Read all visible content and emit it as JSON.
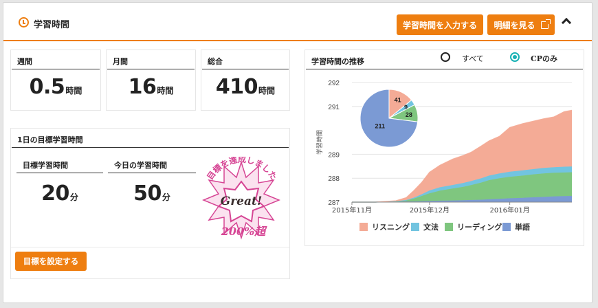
{
  "header": {
    "title": "学習時間",
    "input_button": "学習時間を入力する",
    "detail_button": "明細を見る"
  },
  "stats": {
    "weekly": {
      "label": "週間",
      "value": "0.5",
      "unit": "時間"
    },
    "monthly": {
      "label": "月間",
      "value": "16",
      "unit": "時間"
    },
    "total": {
      "label": "総合",
      "value": "410",
      "unit": "時間"
    }
  },
  "daily_goal": {
    "section_title": "1日の目標学習時間",
    "target": {
      "label": "目標学習時間",
      "value": "20",
      "unit": "分"
    },
    "today": {
      "label": "今日の学習時間",
      "value": "50",
      "unit": "分"
    },
    "stamp": {
      "arc_text": "目標を達成しました",
      "great": "Great!",
      "percent": "200%超"
    },
    "set_goal_button": "目標を設定する"
  },
  "chart_panel": {
    "title": "学習時間の推移",
    "filter_all": "すべて",
    "filter_cp": "CPのみ",
    "selected_filter": "CPのみ"
  },
  "chart_data": [
    {
      "type": "area",
      "stacked": true,
      "ylabel": "学習時間",
      "ylim": [
        287,
        292
      ],
      "yticks": [
        "287",
        "288",
        "289",
        "291",
        "292"
      ],
      "x_tick_labels": [
        "2015年11月",
        "2015年12月",
        "2016年01月"
      ],
      "x": [
        "2015-11-01",
        "2015-11-10",
        "2015-11-18",
        "2015-11-22",
        "2015-11-25",
        "2015-11-28",
        "2015-12-01",
        "2015-12-05",
        "2015-12-10",
        "2015-12-14",
        "2015-12-17",
        "2015-12-21",
        "2015-12-24",
        "2015-12-28",
        "2016-01-01",
        "2016-01-06",
        "2016-01-10",
        "2016-01-14",
        "2016-01-18",
        "2016-01-22",
        "2016-01-25"
      ],
      "grid": true,
      "series": [
        {
          "name": "単語",
          "color": "#7b9ad4",
          "values": [
            0,
            0,
            0.02,
            0.03,
            0.03,
            0.04,
            0.05,
            0.06,
            0.07,
            0.08,
            0.09,
            0.1,
            0.12,
            0.14,
            0.16,
            0.18,
            0.2,
            0.22,
            0.24,
            0.25,
            0.26
          ]
        },
        {
          "name": "リーディング",
          "color": "#7fc67f",
          "values": [
            0,
            0,
            0.01,
            0.04,
            0.12,
            0.22,
            0.32,
            0.42,
            0.5,
            0.56,
            0.62,
            0.72,
            0.8,
            0.86,
            0.9,
            0.93,
            0.96,
            0.98,
            0.99,
            0.99,
            0.99
          ]
        },
        {
          "name": "文法",
          "color": "#72c4e0",
          "values": [
            0,
            0,
            0.01,
            0.02,
            0.04,
            0.07,
            0.12,
            0.14,
            0.15,
            0.16,
            0.17,
            0.18,
            0.19,
            0.2,
            0.21,
            0.22,
            0.22,
            0.23,
            0.23,
            0.24,
            0.24
          ]
        },
        {
          "name": "リスニング",
          "color": "#f4ab96",
          "values": [
            0,
            0,
            0.02,
            0.1,
            0.3,
            0.5,
            0.76,
            0.92,
            1.08,
            1.15,
            1.2,
            1.35,
            1.45,
            1.55,
            1.85,
            1.95,
            2.0,
            2.05,
            2.1,
            2.3,
            2.35
          ]
        }
      ]
    },
    {
      "type": "pie",
      "slices": [
        {
          "label": "リスニング",
          "value": 41,
          "color": "#f4ab96"
        },
        {
          "label": "文法",
          "value": 9,
          "color": "#72c4e0"
        },
        {
          "label": "リーディング",
          "value": 28,
          "color": "#7fc67f"
        },
        {
          "label": "単語",
          "value": 211,
          "color": "#7b9ad4"
        }
      ]
    }
  ]
}
